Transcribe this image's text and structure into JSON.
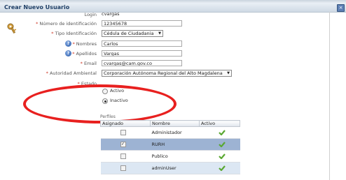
{
  "window": {
    "title": "Crear Nuevo Usuario",
    "close_glyph": "×"
  },
  "form": {
    "login": {
      "label": "Login",
      "value": "cvargas"
    },
    "numero_identificacion": {
      "label": "Número de identificación",
      "value": "12345678"
    },
    "tipo_identificacion": {
      "label": "Tipo Identificación",
      "value": "Cédula de Ciudadania"
    },
    "nombres": {
      "label": "Nombres",
      "value": "Carlos"
    },
    "apellidos": {
      "label": "Apellidos",
      "value": "Vargas"
    },
    "email": {
      "label": "Email",
      "value": "cvargas@cam.gov.co"
    },
    "autoridad": {
      "label": "Autoridad Ambiental",
      "value": "Corporación Autónoma Regional del Alto Magdalena"
    },
    "estado": {
      "label": "Estado",
      "options": [
        "Activo",
        "Inactivo"
      ],
      "selected": "Inactivo"
    }
  },
  "perfiles": {
    "label": "Perfiles",
    "columns": [
      "Asignado",
      "Nombre",
      "Activo"
    ],
    "rows": [
      {
        "nombre": "Administador",
        "asignado": false,
        "activo": true
      },
      {
        "nombre": "RURH",
        "asignado": true,
        "activo": true
      },
      {
        "nombre": "Publico",
        "asignado": false,
        "activo": true
      },
      {
        "nombre": "adminUser",
        "asignado": false,
        "activo": true
      }
    ]
  },
  "colors": {
    "annotation": "#e8201f",
    "check": "#5aa832",
    "selected_row": "#9db3d3"
  },
  "icons": [
    "key-icon",
    "help-icon",
    "close-icon",
    "checkmark-icon",
    "dropdown-caret-icon"
  ]
}
